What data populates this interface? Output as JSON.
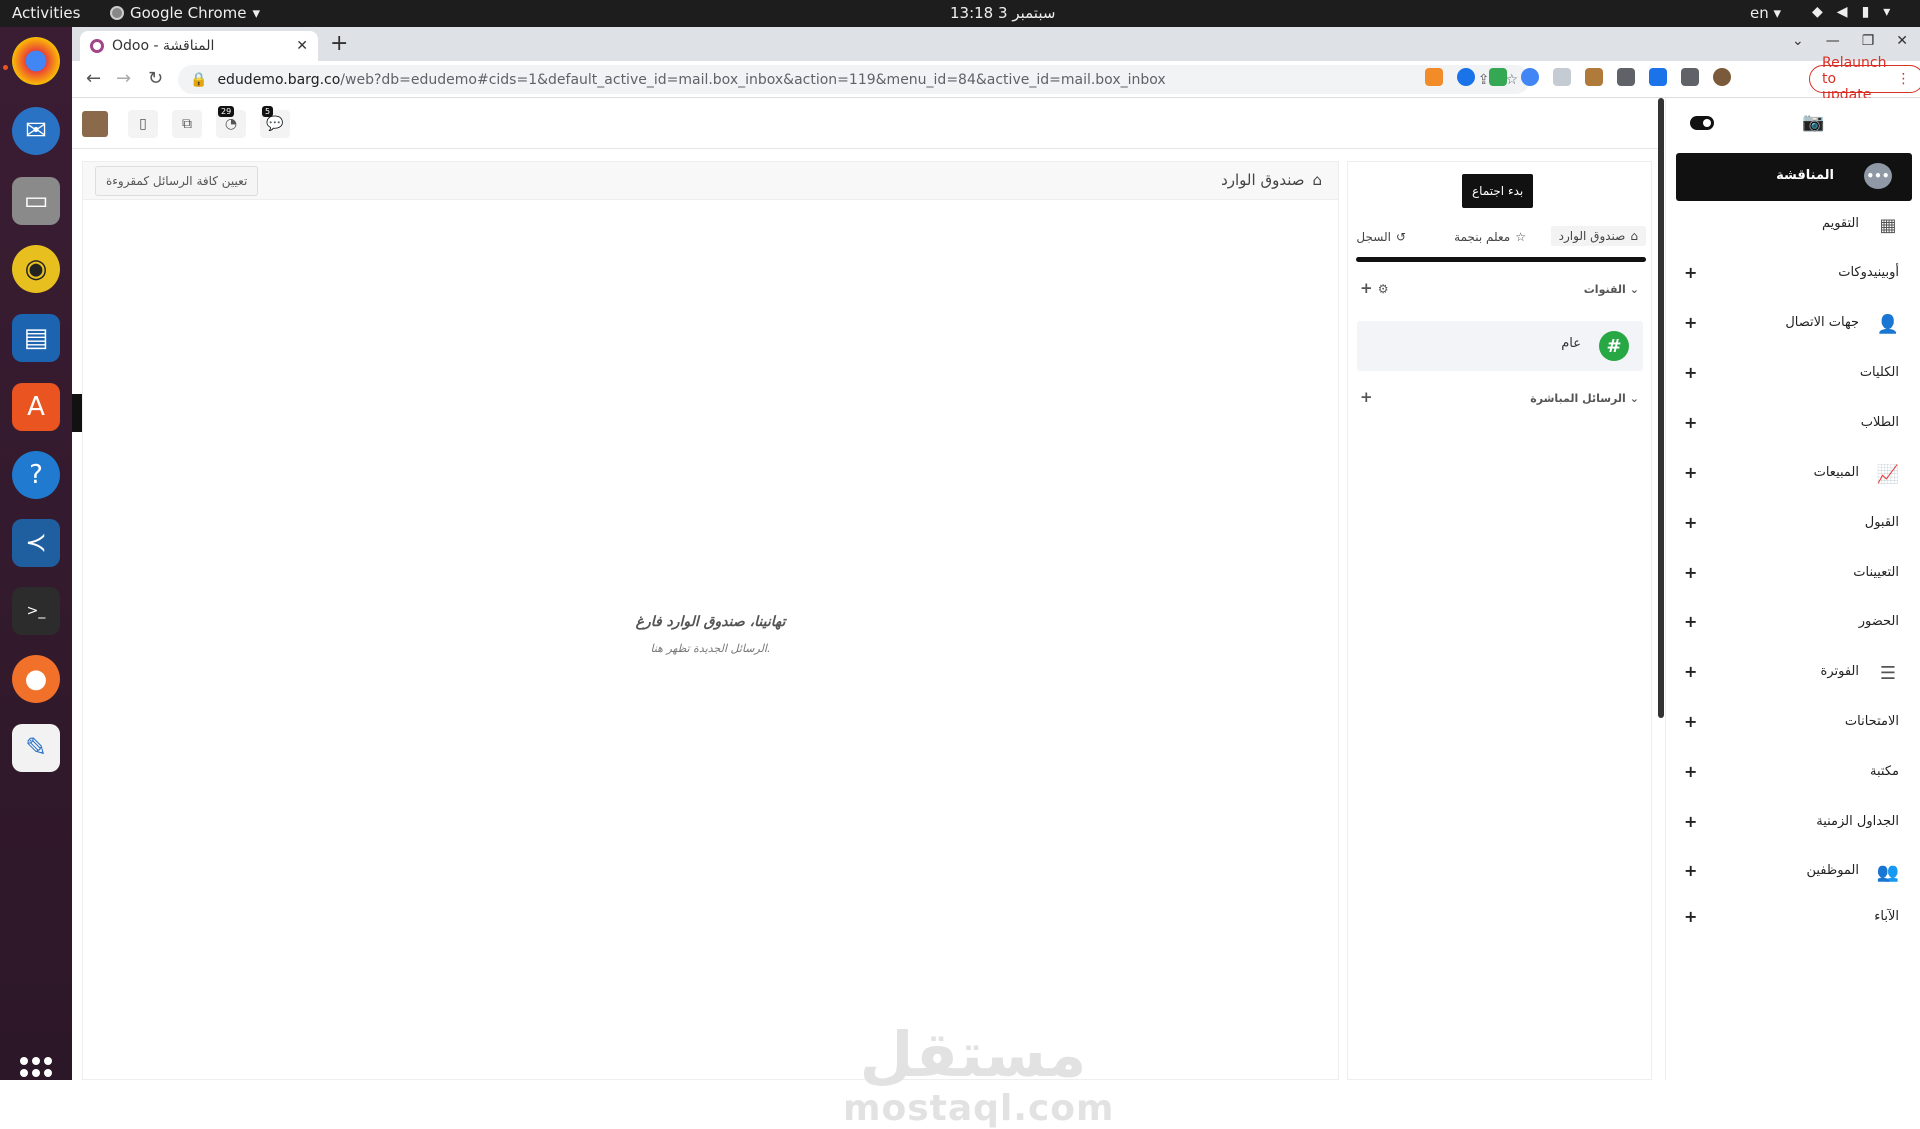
{
  "os": {
    "activities": "Activities",
    "app_name": "Google Chrome",
    "clock": "13:18  3 سبتمبر",
    "lang": "en"
  },
  "chrome": {
    "tab_title": "Odoo - المناقشة",
    "url_host": "edudemo.barg.co",
    "url_path": "/web?db=edudemo#cids=1&default_active_id=mail.box_inbox&action=119&menu_id=84&active_id=mail.box_inbox",
    "relaunch": "Relaunch to update"
  },
  "systray": {
    "badge_chat": "29",
    "badge_activity": "5"
  },
  "thread": {
    "title": "صندوق الوارد",
    "mark_all_read": "تعيين كافة الرسائل كمقروءة",
    "empty_title": "تهانينا، صندوق الوارد فارغ",
    "empty_sub": "الرسائل الجديدة تظهر هنا."
  },
  "watermark": {
    "ar": "مستقل",
    "en": "mostaql.com"
  },
  "discuss": {
    "start_meeting": "بدء اجتماع",
    "tabs": [
      "صندوق الوارد",
      "معلم بنجمة",
      "السجل"
    ],
    "channels_header": "القنوات",
    "channel_name": "عام",
    "dm_header": "الرسائل المباشرة"
  },
  "appmenu": {
    "active": "المناقشة",
    "items": [
      {
        "label": "التقويم",
        "icon": "calendar-icon"
      },
      {
        "label": "أوبينيدوكات",
        "icon": ""
      },
      {
        "label": "جهات الاتصال",
        "icon": "contacts-icon"
      },
      {
        "label": "الكليات",
        "icon": ""
      },
      {
        "label": "الطلاب",
        "icon": ""
      },
      {
        "label": "المبيعات",
        "icon": "sales-chart-icon"
      },
      {
        "label": "القبول",
        "icon": ""
      },
      {
        "label": "التعيينات",
        "icon": ""
      },
      {
        "label": "الحضور",
        "icon": ""
      },
      {
        "label": "الفوترة",
        "icon": "invoice-icon"
      },
      {
        "label": "الامتحانات",
        "icon": ""
      },
      {
        "label": "مكتبة",
        "icon": ""
      },
      {
        "label": "الجداول الزمنية",
        "icon": ""
      },
      {
        "label": "الموظفين",
        "icon": "employees-icon"
      },
      {
        "label": "الآباء",
        "icon": ""
      }
    ]
  },
  "colors": {
    "odoo_brand": "#a24689",
    "relaunch": "#d93025",
    "channel_green": "#28a745",
    "active_menu": "#111111"
  }
}
